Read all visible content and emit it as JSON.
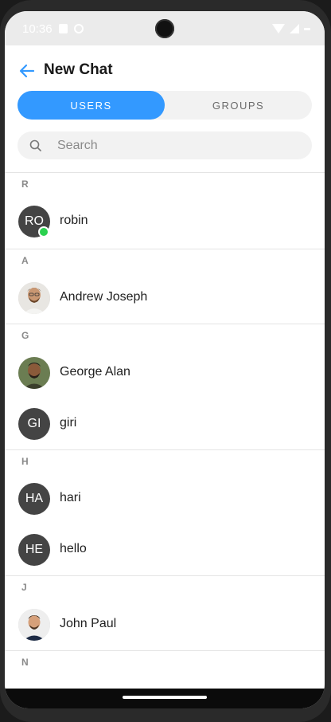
{
  "status_bar": {
    "time": "10:36"
  },
  "header": {
    "title": "New Chat"
  },
  "tabs": {
    "users_label": "USERS",
    "groups_label": "GROUPS"
  },
  "search": {
    "placeholder": "Search"
  },
  "sections": [
    {
      "letter": "R",
      "users": [
        {
          "name": "robin",
          "initials": "RO",
          "online": true
        }
      ]
    },
    {
      "letter": "A",
      "users": [
        {
          "name": "Andrew Joseph",
          "initials": "",
          "online": false
        }
      ]
    },
    {
      "letter": "G",
      "users": [
        {
          "name": "George Alan",
          "initials": "",
          "online": false
        },
        {
          "name": "giri",
          "initials": "GI",
          "online": false
        }
      ]
    },
    {
      "letter": "H",
      "users": [
        {
          "name": "hari",
          "initials": "HA",
          "online": false
        },
        {
          "name": "hello",
          "initials": "HE",
          "online": false
        }
      ]
    },
    {
      "letter": "J",
      "users": [
        {
          "name": "John Paul",
          "initials": "",
          "online": false
        }
      ]
    },
    {
      "letter": "N",
      "users": []
    }
  ],
  "colors": {
    "accent": "#3399ff",
    "online": "#2bd14f",
    "avatar_bg": "#444444"
  }
}
